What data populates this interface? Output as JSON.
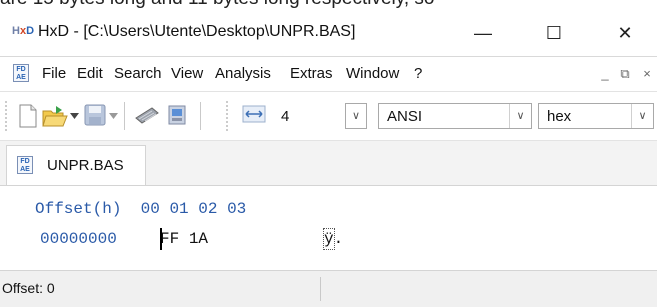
{
  "background_text": "are 15 bytes long and 11 bytes long respectively, so",
  "window": {
    "app_icon": "hxd-icon",
    "title": "HxD - [C:\\Users\\Utente\\Desktop\\UNPR.BAS]",
    "minimize": "—",
    "maximize": "☐",
    "close": "✕"
  },
  "menu": {
    "items": [
      "File",
      "Edit",
      "Search",
      "View",
      "Analysis",
      "Extras",
      "Window",
      "?"
    ],
    "mdi_minimize": "_",
    "mdi_restore": "⧉",
    "mdi_close": "×"
  },
  "toolbar": {
    "icons": [
      "new-file-icon",
      "open-file-icon",
      "save-icon",
      "ram-icon",
      "disk-icon",
      "bytes-per-row-icon"
    ],
    "bytes_per_row": "4",
    "charset": "ANSI",
    "offset_base": "hex"
  },
  "tab": {
    "label": "UNPR.BAS"
  },
  "editor": {
    "header_label": "Offset(h)",
    "column_headers": [
      "00",
      "01",
      "02",
      "03"
    ],
    "rows": [
      {
        "offset": "00000000",
        "bytes": [
          "FF",
          "1A"
        ],
        "text": "ÿ."
      }
    ]
  },
  "status": {
    "offset_text": "Offset: 0"
  },
  "colors": {
    "offset_blue": "#2a5aa8",
    "hxd_red": "#d24726"
  }
}
